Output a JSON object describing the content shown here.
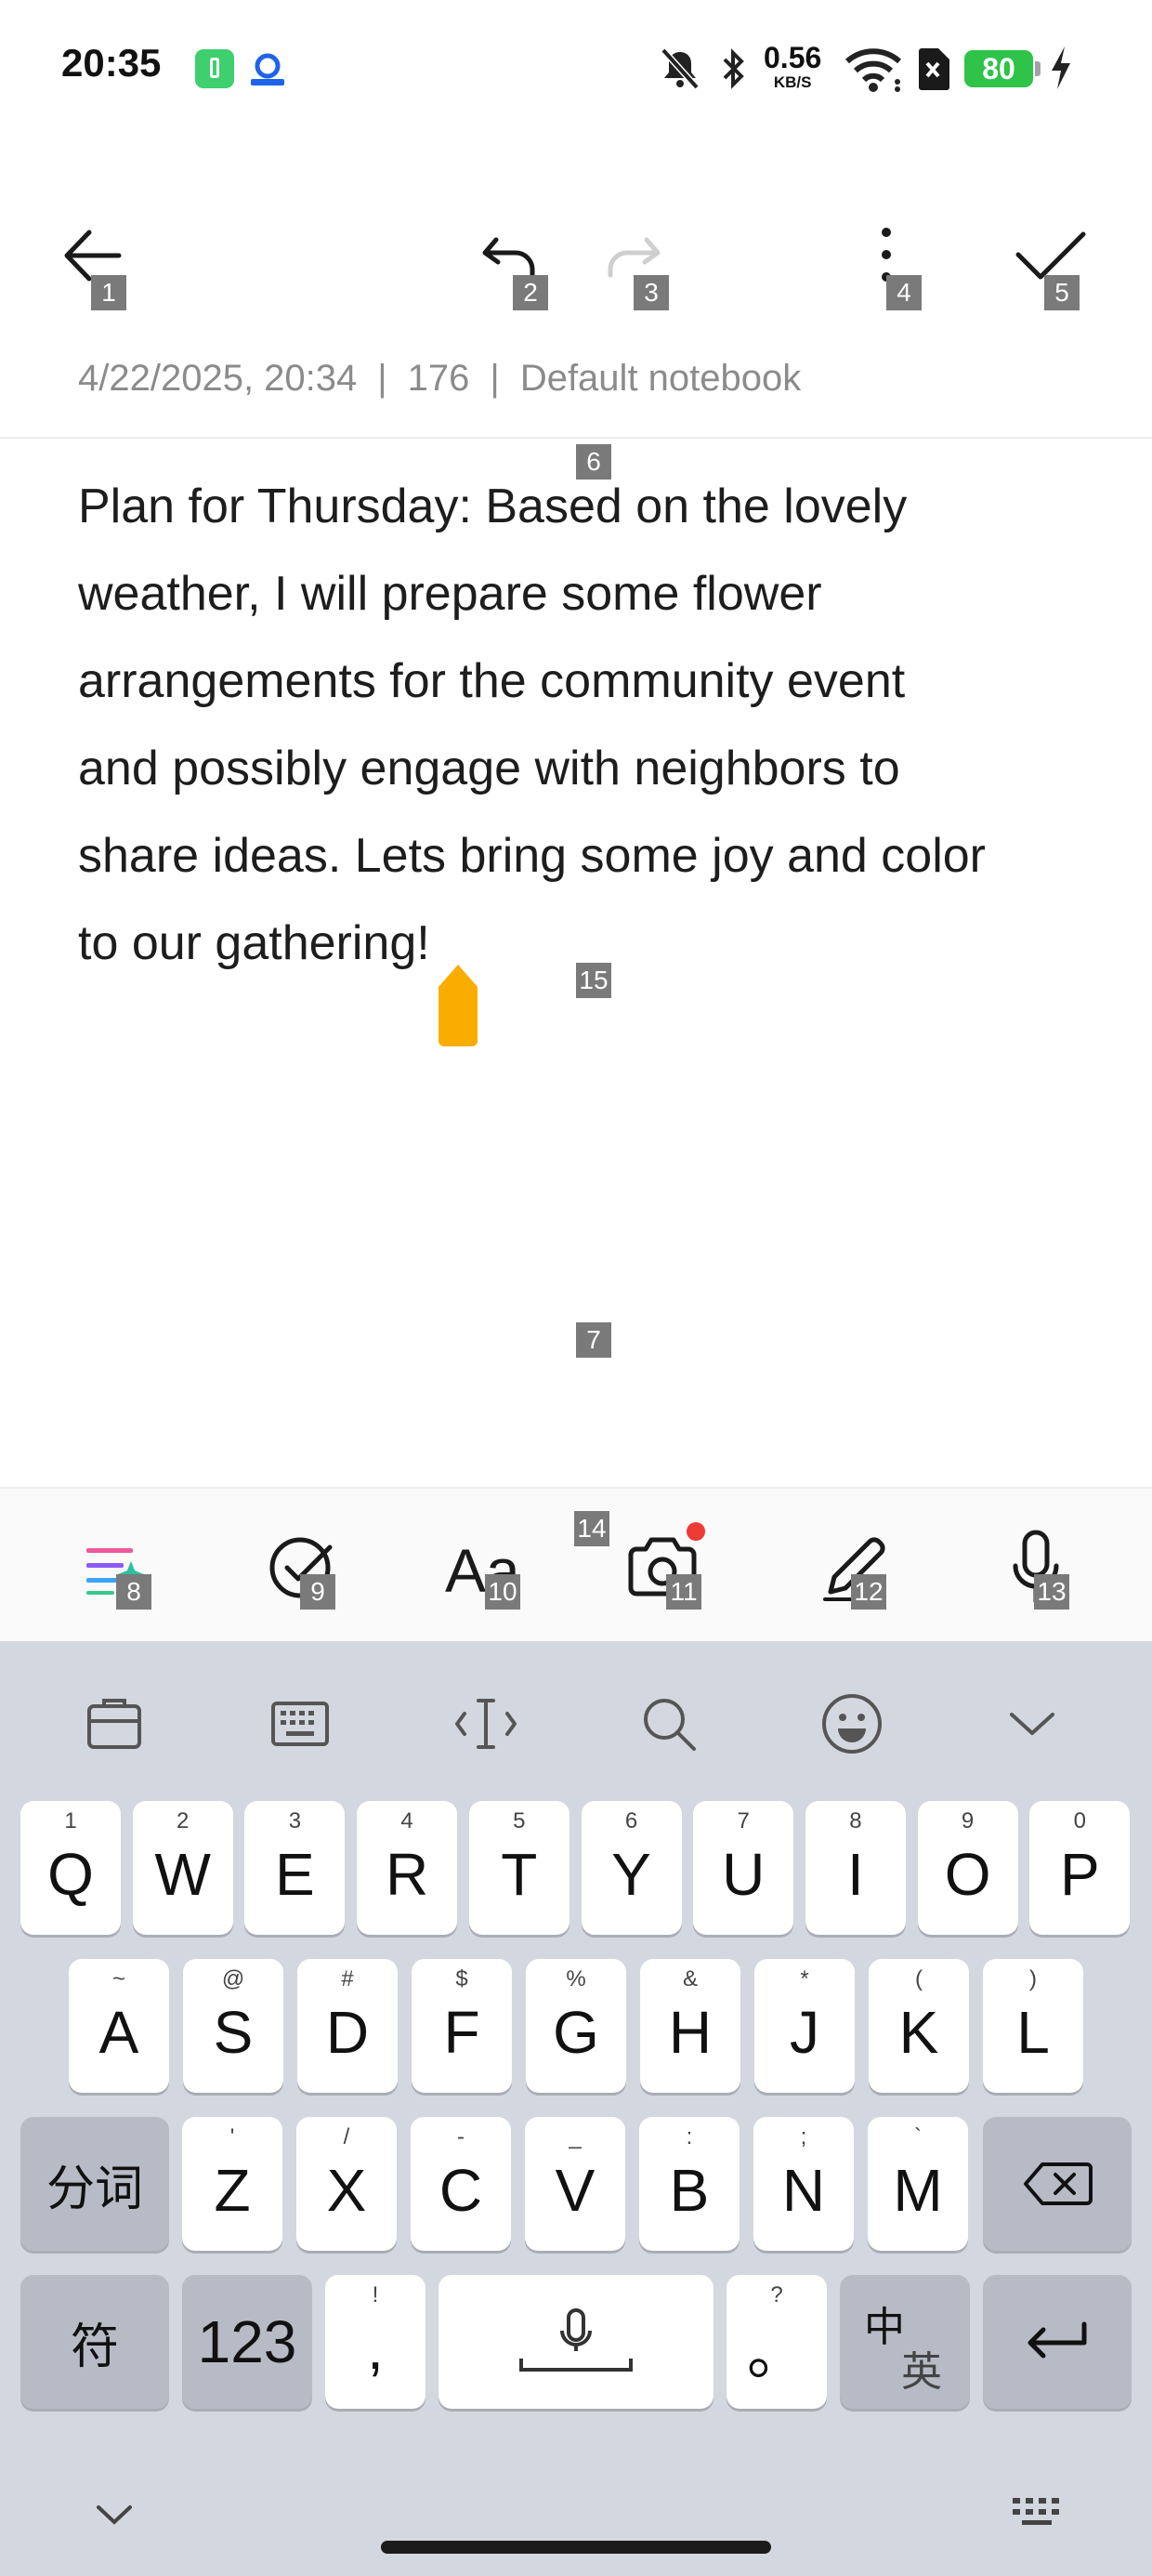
{
  "status_bar": {
    "time": "20:35",
    "network_speed_value": "0.56",
    "network_speed_unit": "KB/S",
    "battery_percent": "80",
    "icons": [
      "battery-saver-app-icon",
      "app-notification-icon",
      "mute-icon",
      "bluetooth-icon",
      "wifi-icon",
      "sim-off-icon",
      "battery-icon",
      "charging-icon"
    ]
  },
  "top_bar": {
    "markers": {
      "back": "1",
      "undo": "2",
      "redo": "3",
      "more": "4",
      "done": "5"
    }
  },
  "meta": {
    "datetime": "4/22/2025, 20:34",
    "separator": "|",
    "char_count": "176",
    "notebook": "Default notebook"
  },
  "note": {
    "lines": [
      "Plan for Thursday: Based on the lovely",
      "weather, I will prepare some flower",
      "arrangements for the community event",
      "and possibly engage with neighbors to",
      "share ideas. Lets bring some joy and color",
      "to our gathering!"
    ],
    "markers": {
      "title_area": "6",
      "body_area": "7",
      "cursor": "15"
    }
  },
  "edit_toolbar": {
    "markers": {
      "ai_style": "8",
      "checklist": "9",
      "text_format": "10",
      "camera": "11",
      "handwriting": "12",
      "voice": "13",
      "camera_badge": "14"
    },
    "badge_color": "#ef3b36"
  },
  "keyboard": {
    "row1": [
      {
        "hint": "1",
        "key": "Q"
      },
      {
        "hint": "2",
        "key": "W"
      },
      {
        "hint": "3",
        "key": "E"
      },
      {
        "hint": "4",
        "key": "R"
      },
      {
        "hint": "5",
        "key": "T"
      },
      {
        "hint": "6",
        "key": "Y"
      },
      {
        "hint": "7",
        "key": "U"
      },
      {
        "hint": "8",
        "key": "I"
      },
      {
        "hint": "9",
        "key": "O"
      },
      {
        "hint": "0",
        "key": "P"
      }
    ],
    "row2": [
      {
        "hint": "~",
        "key": "A"
      },
      {
        "hint": "@",
        "key": "S"
      },
      {
        "hint": "#",
        "key": "D"
      },
      {
        "hint": "$",
        "key": "F"
      },
      {
        "hint": "%",
        "key": "G"
      },
      {
        "hint": "&",
        "key": "H"
      },
      {
        "hint": "*",
        "key": "J"
      },
      {
        "hint": "(",
        "key": "K"
      },
      {
        "hint": ")",
        "key": "L"
      }
    ],
    "row3": [
      {
        "hint": "'",
        "key": "Z"
      },
      {
        "hint": "/",
        "key": "X"
      },
      {
        "hint": "-",
        "key": "C"
      },
      {
        "hint": "_",
        "key": "V"
      },
      {
        "hint": ":",
        "key": "B"
      },
      {
        "hint": ";",
        "key": "N"
      },
      {
        "hint": "`",
        "key": "M"
      }
    ],
    "split_word_label": "分词",
    "symbols_label": "符",
    "numbers_label": "123",
    "comma_label": ",",
    "comma_hint": "!",
    "period_label": "。",
    "period_hint": "?",
    "lang_switch_label_zh": "中",
    "lang_switch_label_en": "英"
  },
  "colors": {
    "accent": "#f9ad00",
    "marker_bg": "#7a7a7a",
    "keyboard_bg": "#d3d7df"
  }
}
